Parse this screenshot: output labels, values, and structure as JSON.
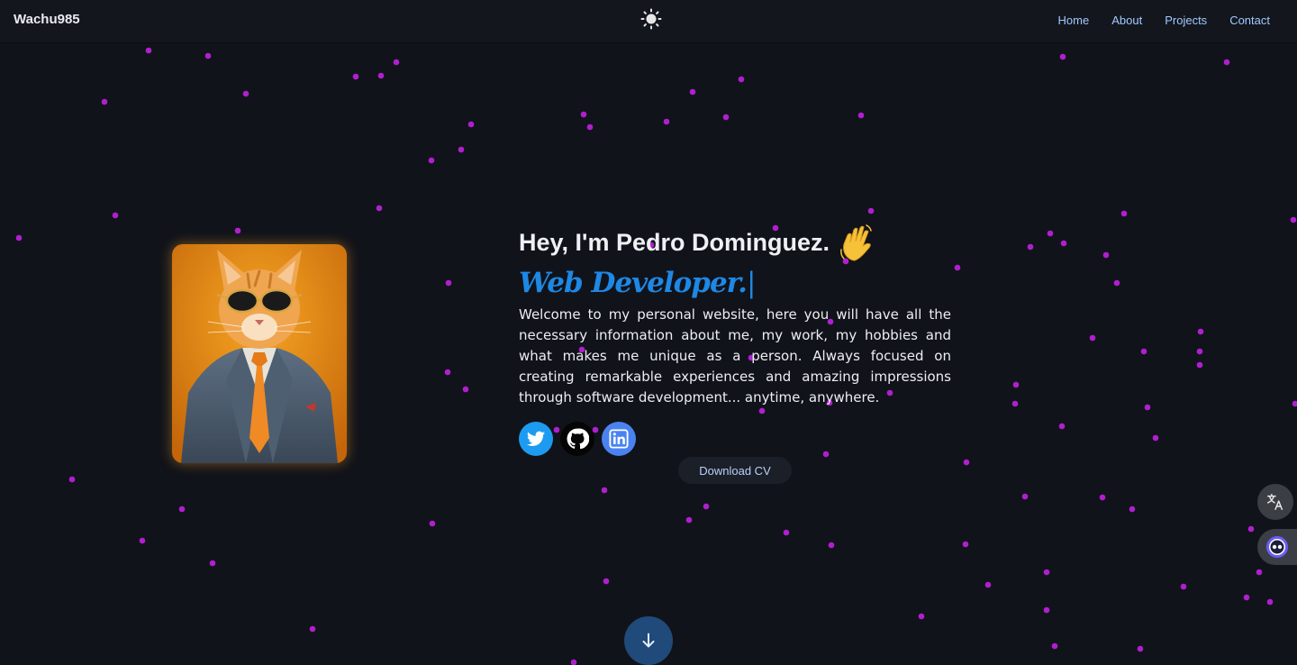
{
  "nav": {
    "brand": "Wachu985",
    "theme_icon": "sun-icon",
    "links": [
      "Home",
      "About",
      "Projects",
      "Contact"
    ]
  },
  "hero": {
    "greeting": "Hey, I'm Pedro Dominguez.",
    "wave_icon": "waving-hand-icon",
    "role": "Web Developer.",
    "cursor": "|",
    "intro": "Welcome to my personal website, here you will have all the necessary information about me, my work, my hobbies and what makes me unique as a person. Always focused on creating remarkable experiences and amazing impressions through software development... anytime, anywhere.",
    "avatar_alt": "cat-in-suit-avatar"
  },
  "socials": [
    {
      "name": "twitter",
      "icon": "twitter-icon",
      "color": "#1d9bf0"
    },
    {
      "name": "github",
      "icon": "github-icon",
      "color": "#050505"
    },
    {
      "name": "linkedin",
      "icon": "linkedin-icon",
      "color": "#4a83f0"
    }
  ],
  "cv_button": "Download CV",
  "scroll_icon": "arrow-down-icon",
  "floating": {
    "translate_icon": "translate-icon",
    "assistant_icon": "assistant-icon"
  },
  "colors": {
    "background": "#11131a",
    "navbar": "#14161d",
    "accent": "#1e88e5",
    "particle": "#b01fcf",
    "nav_link": "#9ecaff"
  }
}
